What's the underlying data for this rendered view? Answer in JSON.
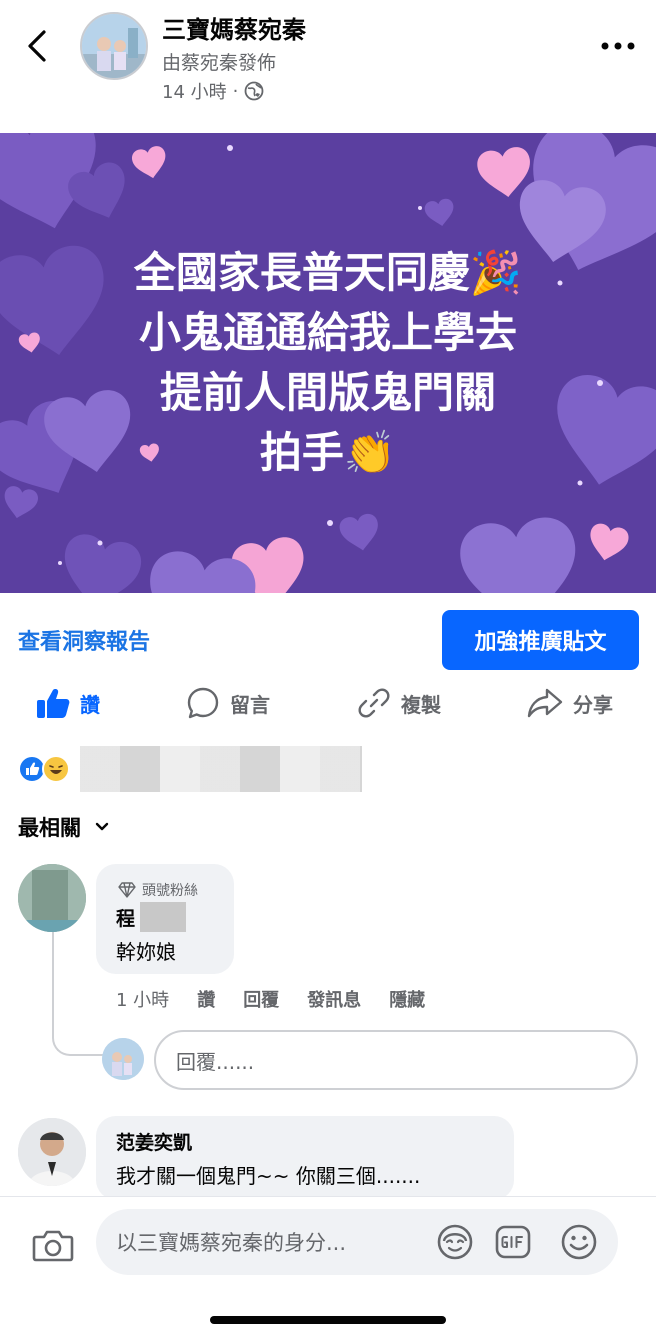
{
  "header": {
    "page_name": "三寶媽蔡宛秦",
    "posted_by": "由蔡宛秦發佈",
    "time": "14 小時",
    "separator": "·",
    "icons": {
      "back": "chevron-left-icon",
      "more": "more-dots-icon",
      "audience": "globe-icon"
    }
  },
  "banner": {
    "background_color": "#5b3fa0",
    "lines": [
      "全國家長普天同慶🎉",
      "小鬼通通給我上學去",
      "提前人間版鬼門關",
      "拍手👏"
    ]
  },
  "insights": {
    "link": "查看洞察報告",
    "boost_button": "加強推廣貼文",
    "boost_color": "#0866ff"
  },
  "actions": {
    "like": "讚",
    "comment": "留言",
    "copy": "複製",
    "share": "分享",
    "like_color": "#0866ff"
  },
  "sort": {
    "label": "最相關"
  },
  "comments": [
    {
      "badge": "頭號粉絲",
      "name": "程",
      "text": "幹妳娘",
      "time": "1 小時",
      "actions": [
        "讚",
        "回覆",
        "發訊息",
        "隱藏"
      ]
    },
    {
      "name": "范姜奕凱",
      "text": "我才關一個鬼門~~ 你關三個......."
    }
  ],
  "reply": {
    "placeholder": "回覆......"
  },
  "composer": {
    "placeholder": "以三寶媽蔡宛秦的身分..."
  }
}
